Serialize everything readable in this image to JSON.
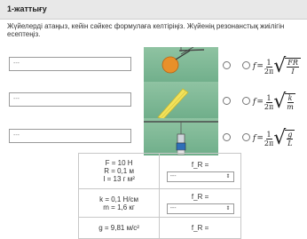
{
  "header": {
    "title": "1-жаттығу"
  },
  "instruction": "Жүйелерді атаңыз, кейін сәйкес формулаға келтіріңіз. Жүйенің резонанстық жиілігін есептеңіз.",
  "rows": [
    {
      "input_value": "---",
      "picture_icon": "ball-pendulum-icon",
      "formula": {
        "f": "f",
        "eq": "=",
        "num": "1",
        "den": "2π",
        "rad_num": "FR",
        "rad_den": "I"
      }
    },
    {
      "input_value": "---",
      "picture_icon": "spring-block-icon",
      "formula": {
        "f": "f",
        "eq": "=",
        "num": "1",
        "den": "2π",
        "rad_num": "k",
        "rad_den": "m"
      }
    },
    {
      "input_value": "---",
      "picture_icon": "hanging-mass-icon",
      "formula": {
        "f": "f",
        "eq": "=",
        "num": "1",
        "den": "2π",
        "rad_num": "g",
        "rad_den": "L"
      }
    }
  ],
  "table": [
    {
      "params": [
        "F = 10 Н",
        "R = 0,1 м",
        "I = 13 г м²"
      ],
      "label": "f_R =",
      "select_value": "---",
      "select_icon": "dropdown-icon"
    },
    {
      "params": [
        "k = 0,1 Н/см",
        "m = 1,6 кг"
      ],
      "label": "f_R =",
      "select_value": "---",
      "select_icon": "dropdown-icon"
    },
    {
      "params": [
        "g = 9,81 м/с²"
      ],
      "label": "f_R =",
      "select_value": "---",
      "select_icon": "dropdown-icon"
    }
  ],
  "colors": {
    "header_bg": "#e8e8e8",
    "picture_bg": "#7fb896",
    "ball": "#e8902a",
    "spring": "#f2e25a"
  }
}
